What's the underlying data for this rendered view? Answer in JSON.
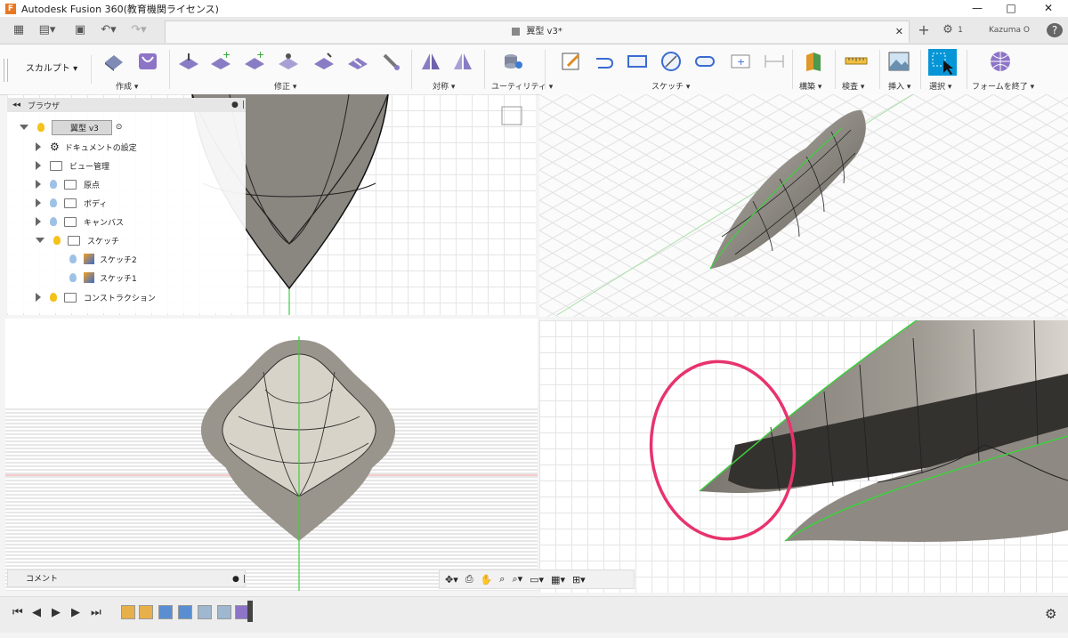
{
  "window": {
    "title": "Autodesk Fusion 360(教育機関ライセンス)",
    "logo": "F",
    "controls": [
      "—",
      "□",
      "✕"
    ]
  },
  "qat": {
    "document_tab": "翼型 v3*",
    "jobs": "1",
    "user": "Kazuma O"
  },
  "ribbon": {
    "workspace": "スカルプト",
    "groups": [
      "作成",
      "修正",
      "対称",
      "ユーティリティ",
      "スケッチ",
      "構築",
      "検査",
      "挿入",
      "選択",
      "フォームを終了"
    ]
  },
  "browser": {
    "title": "ブラウザ",
    "root": "翼型 v3",
    "items": [
      {
        "label": "ドキュメントの設定",
        "icon": "gear"
      },
      {
        "label": "ビュー管理",
        "icon": "folder"
      },
      {
        "label": "原点",
        "icon": "folder"
      },
      {
        "label": "ボディ",
        "icon": "folder"
      },
      {
        "label": "キャンバス",
        "icon": "folder"
      },
      {
        "label": "スケッチ",
        "icon": "folder",
        "open": true
      },
      {
        "label": "スケッチ2",
        "icon": "sketch",
        "child": true
      },
      {
        "label": "スケッチ1",
        "icon": "sketch",
        "child": true
      },
      {
        "label": "コンストラクション",
        "icon": "folder"
      }
    ]
  },
  "comments": {
    "label": "コメント"
  },
  "colors": {
    "accent_blue": "#0696d7",
    "highlight_circle": "#e8336d",
    "edge_green": "#3ecf3e",
    "model_gray": "#8a8680"
  }
}
